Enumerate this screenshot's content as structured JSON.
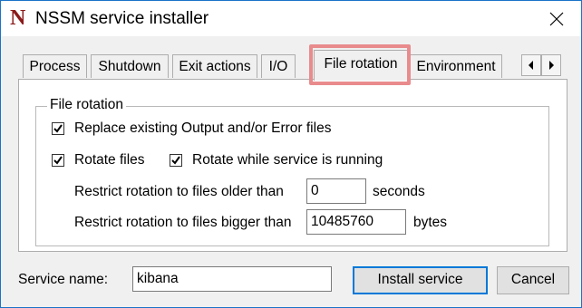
{
  "window": {
    "title": "NSSM service installer",
    "logo_letter": "N"
  },
  "tabs": [
    {
      "label": "Process"
    },
    {
      "label": "Shutdown"
    },
    {
      "label": "Exit actions"
    },
    {
      "label": "I/O"
    },
    {
      "label": "File rotation",
      "active": true
    },
    {
      "label": "Environment"
    }
  ],
  "file_rotation": {
    "group_title": "File rotation",
    "replace_existing": {
      "label": "Replace existing Output and/or Error files",
      "checked": true
    },
    "rotate_files": {
      "label": "Rotate files",
      "checked": true
    },
    "rotate_online": {
      "label": "Rotate while service is running",
      "checked": true
    },
    "older_than": {
      "label": "Restrict rotation to files older than",
      "value": "0",
      "unit": "seconds"
    },
    "bigger_than": {
      "label": "Restrict rotation to files bigger than",
      "value": "10485760",
      "unit": "bytes"
    }
  },
  "service": {
    "label": "Service name:",
    "value": "kibana"
  },
  "buttons": {
    "install": "Install service",
    "cancel": "Cancel"
  },
  "colors": {
    "highlight": "#e98b8d",
    "logo": "#8b1a1a",
    "default_button_border": "#0078d7"
  }
}
